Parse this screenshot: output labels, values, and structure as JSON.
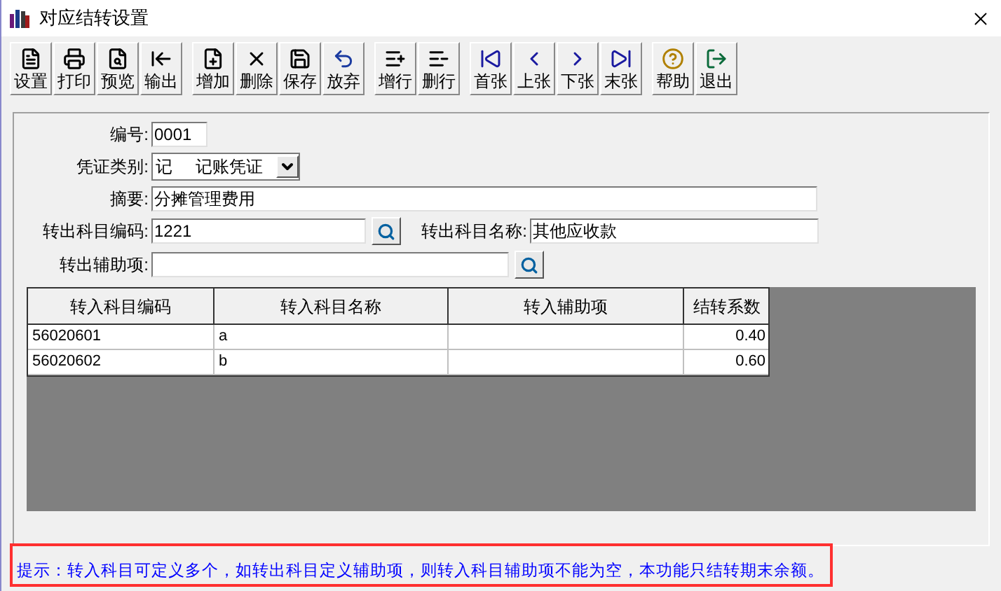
{
  "window": {
    "title": "对应结转设置"
  },
  "toolbar": [
    [
      "设置",
      "打印",
      "预览",
      "输出"
    ],
    [
      "增加",
      "删除",
      "保存",
      "放弃"
    ],
    [
      "增行",
      "删行"
    ],
    [
      "首张",
      "上张",
      "下张",
      "末张"
    ],
    [
      "帮助",
      "退出"
    ]
  ],
  "form": {
    "number": {
      "label": "编号:",
      "value": "0001"
    },
    "voucher_type": {
      "label": "凭证类别:",
      "value": "记     记账凭证"
    },
    "summary": {
      "label": "摘要:",
      "value": "分摊管理费用"
    },
    "out_code": {
      "label": "转出科目编码:",
      "value": "1221"
    },
    "out_name": {
      "label": "转出科目名称:",
      "value": "其他应收款"
    },
    "out_aux": {
      "label": "转出辅助项:"
    }
  },
  "table": {
    "columns": [
      "转入科目编码",
      "转入科目名称",
      "转入辅助项",
      "结转系数"
    ],
    "rows": [
      [
        "56020601",
        "a",
        "",
        "0.40"
      ],
      [
        "56020602",
        "b",
        "",
        "0.60"
      ]
    ]
  },
  "hint": "提示：转入科目可定义多个，如转出科目定义辅助项，则转入科目辅助项不能为空，本功能只结转期末余额。"
}
